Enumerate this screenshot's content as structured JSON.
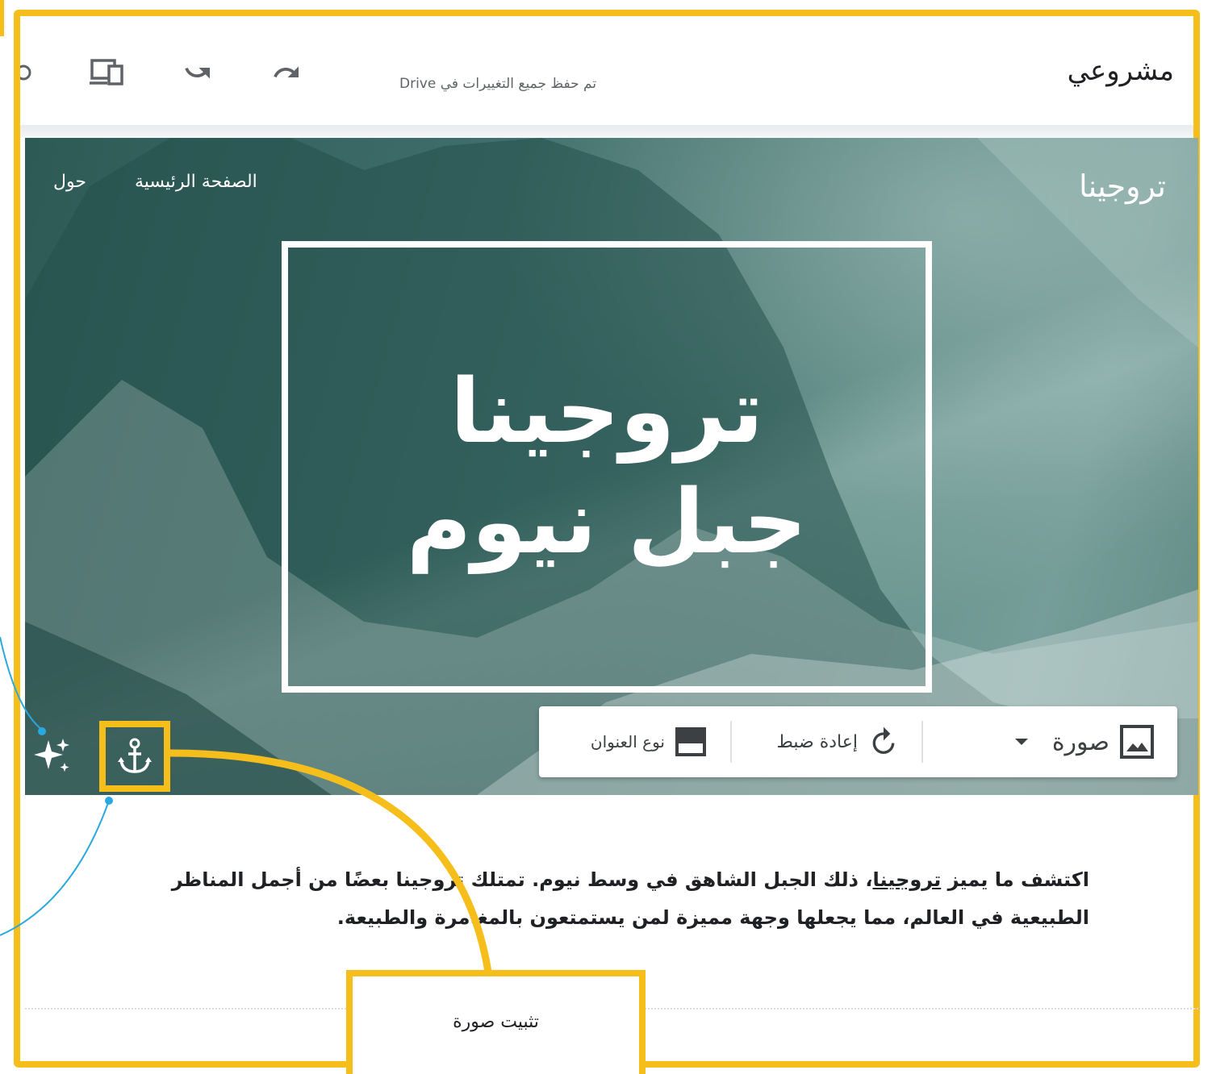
{
  "app": {
    "project_title": "مشروعي",
    "save_status": "تم حفظ جميع التغييرات في Drive"
  },
  "site": {
    "title": "تروجينا",
    "nav": [
      "الصفحة الرئيسية",
      "حول"
    ]
  },
  "hero": {
    "title_line1": "تروجينا",
    "title_line2": "جبل نيوم"
  },
  "image_toolbar": {
    "image_label": "صورة",
    "reset_label": "إعادة ضبط",
    "header_type_label": "نوع العنوان"
  },
  "body": {
    "p1_part1": "اكتشف ما يميز ",
    "p1_link": "تروجينا",
    "p1_part2": "، ذلك الجبل الشاهق في وسط نيوم. تمتلك تروجينا بعضًا من أجمل المناظر",
    "p2": "الطبيعية في العالم، مما يجعلها وجهة مميزة لمن يستمتعون بالمغامرة والطبيعة."
  },
  "callout": {
    "label": "تثبيت صورة"
  },
  "colors": {
    "highlight": "#f5be1b",
    "hero_tint": "#3d6b67",
    "pointer_line": "#29a8e0"
  }
}
